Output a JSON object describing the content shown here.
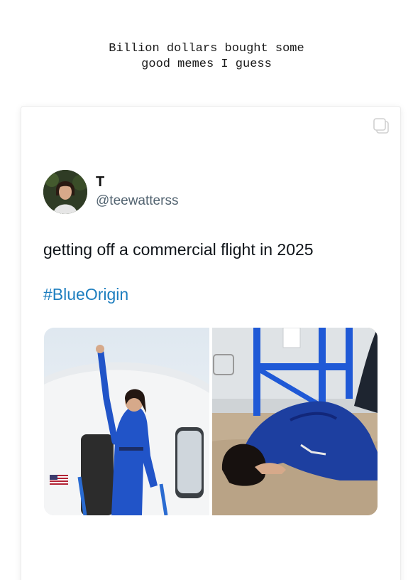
{
  "caption": {
    "line1": "Billion dollars bought some",
    "line2": "good memes I guess"
  },
  "post": {
    "icon": "multiple-images-icon",
    "author": {
      "display_name": "T",
      "handle": "@teewatterss",
      "avatar": "avatar-photo"
    },
    "text": "getting off a commercial flight in 2025",
    "hashtag": "#BlueOrigin",
    "media": [
      {
        "name": "photo-woman-raising-fist-at-capsule-hatch"
      },
      {
        "name": "photo-woman-kneeling-kissing-ground"
      }
    ]
  }
}
